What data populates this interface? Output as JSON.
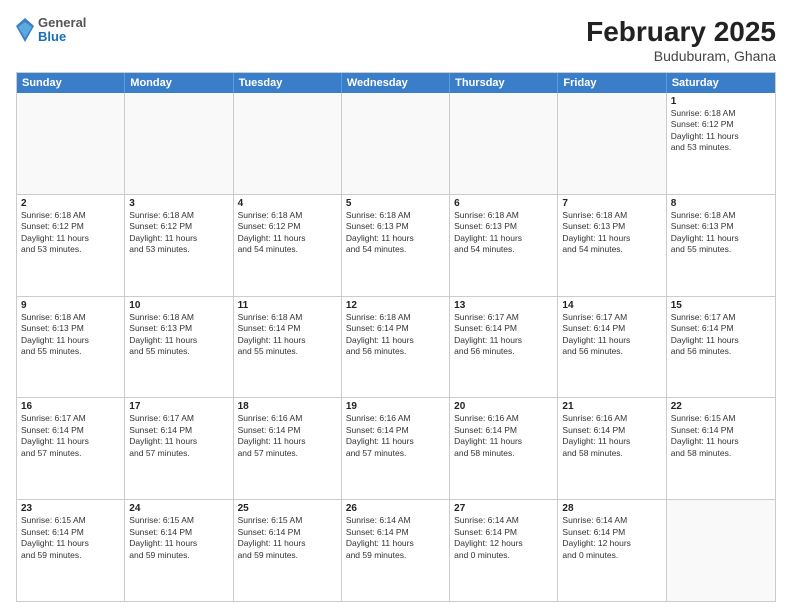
{
  "header": {
    "logo": {
      "general": "General",
      "blue": "Blue"
    },
    "title": "February 2025",
    "subtitle": "Buduburam, Ghana"
  },
  "calendar": {
    "days_of_week": [
      "Sunday",
      "Monday",
      "Tuesday",
      "Wednesday",
      "Thursday",
      "Friday",
      "Saturday"
    ],
    "rows": [
      [
        {
          "day": "",
          "info": ""
        },
        {
          "day": "",
          "info": ""
        },
        {
          "day": "",
          "info": ""
        },
        {
          "day": "",
          "info": ""
        },
        {
          "day": "",
          "info": ""
        },
        {
          "day": "",
          "info": ""
        },
        {
          "day": "1",
          "info": "Sunrise: 6:18 AM\nSunset: 6:12 PM\nDaylight: 11 hours\nand 53 minutes."
        }
      ],
      [
        {
          "day": "2",
          "info": "Sunrise: 6:18 AM\nSunset: 6:12 PM\nDaylight: 11 hours\nand 53 minutes."
        },
        {
          "day": "3",
          "info": "Sunrise: 6:18 AM\nSunset: 6:12 PM\nDaylight: 11 hours\nand 53 minutes."
        },
        {
          "day": "4",
          "info": "Sunrise: 6:18 AM\nSunset: 6:12 PM\nDaylight: 11 hours\nand 54 minutes."
        },
        {
          "day": "5",
          "info": "Sunrise: 6:18 AM\nSunset: 6:13 PM\nDaylight: 11 hours\nand 54 minutes."
        },
        {
          "day": "6",
          "info": "Sunrise: 6:18 AM\nSunset: 6:13 PM\nDaylight: 11 hours\nand 54 minutes."
        },
        {
          "day": "7",
          "info": "Sunrise: 6:18 AM\nSunset: 6:13 PM\nDaylight: 11 hours\nand 54 minutes."
        },
        {
          "day": "8",
          "info": "Sunrise: 6:18 AM\nSunset: 6:13 PM\nDaylight: 11 hours\nand 55 minutes."
        }
      ],
      [
        {
          "day": "9",
          "info": "Sunrise: 6:18 AM\nSunset: 6:13 PM\nDaylight: 11 hours\nand 55 minutes."
        },
        {
          "day": "10",
          "info": "Sunrise: 6:18 AM\nSunset: 6:13 PM\nDaylight: 11 hours\nand 55 minutes."
        },
        {
          "day": "11",
          "info": "Sunrise: 6:18 AM\nSunset: 6:14 PM\nDaylight: 11 hours\nand 55 minutes."
        },
        {
          "day": "12",
          "info": "Sunrise: 6:18 AM\nSunset: 6:14 PM\nDaylight: 11 hours\nand 56 minutes."
        },
        {
          "day": "13",
          "info": "Sunrise: 6:17 AM\nSunset: 6:14 PM\nDaylight: 11 hours\nand 56 minutes."
        },
        {
          "day": "14",
          "info": "Sunrise: 6:17 AM\nSunset: 6:14 PM\nDaylight: 11 hours\nand 56 minutes."
        },
        {
          "day": "15",
          "info": "Sunrise: 6:17 AM\nSunset: 6:14 PM\nDaylight: 11 hours\nand 56 minutes."
        }
      ],
      [
        {
          "day": "16",
          "info": "Sunrise: 6:17 AM\nSunset: 6:14 PM\nDaylight: 11 hours\nand 57 minutes."
        },
        {
          "day": "17",
          "info": "Sunrise: 6:17 AM\nSunset: 6:14 PM\nDaylight: 11 hours\nand 57 minutes."
        },
        {
          "day": "18",
          "info": "Sunrise: 6:16 AM\nSunset: 6:14 PM\nDaylight: 11 hours\nand 57 minutes."
        },
        {
          "day": "19",
          "info": "Sunrise: 6:16 AM\nSunset: 6:14 PM\nDaylight: 11 hours\nand 57 minutes."
        },
        {
          "day": "20",
          "info": "Sunrise: 6:16 AM\nSunset: 6:14 PM\nDaylight: 11 hours\nand 58 minutes."
        },
        {
          "day": "21",
          "info": "Sunrise: 6:16 AM\nSunset: 6:14 PM\nDaylight: 11 hours\nand 58 minutes."
        },
        {
          "day": "22",
          "info": "Sunrise: 6:15 AM\nSunset: 6:14 PM\nDaylight: 11 hours\nand 58 minutes."
        }
      ],
      [
        {
          "day": "23",
          "info": "Sunrise: 6:15 AM\nSunset: 6:14 PM\nDaylight: 11 hours\nand 59 minutes."
        },
        {
          "day": "24",
          "info": "Sunrise: 6:15 AM\nSunset: 6:14 PM\nDaylight: 11 hours\nand 59 minutes."
        },
        {
          "day": "25",
          "info": "Sunrise: 6:15 AM\nSunset: 6:14 PM\nDaylight: 11 hours\nand 59 minutes."
        },
        {
          "day": "26",
          "info": "Sunrise: 6:14 AM\nSunset: 6:14 PM\nDaylight: 11 hours\nand 59 minutes."
        },
        {
          "day": "27",
          "info": "Sunrise: 6:14 AM\nSunset: 6:14 PM\nDaylight: 12 hours\nand 0 minutes."
        },
        {
          "day": "28",
          "info": "Sunrise: 6:14 AM\nSunset: 6:14 PM\nDaylight: 12 hours\nand 0 minutes."
        },
        {
          "day": "",
          "info": ""
        }
      ]
    ]
  }
}
